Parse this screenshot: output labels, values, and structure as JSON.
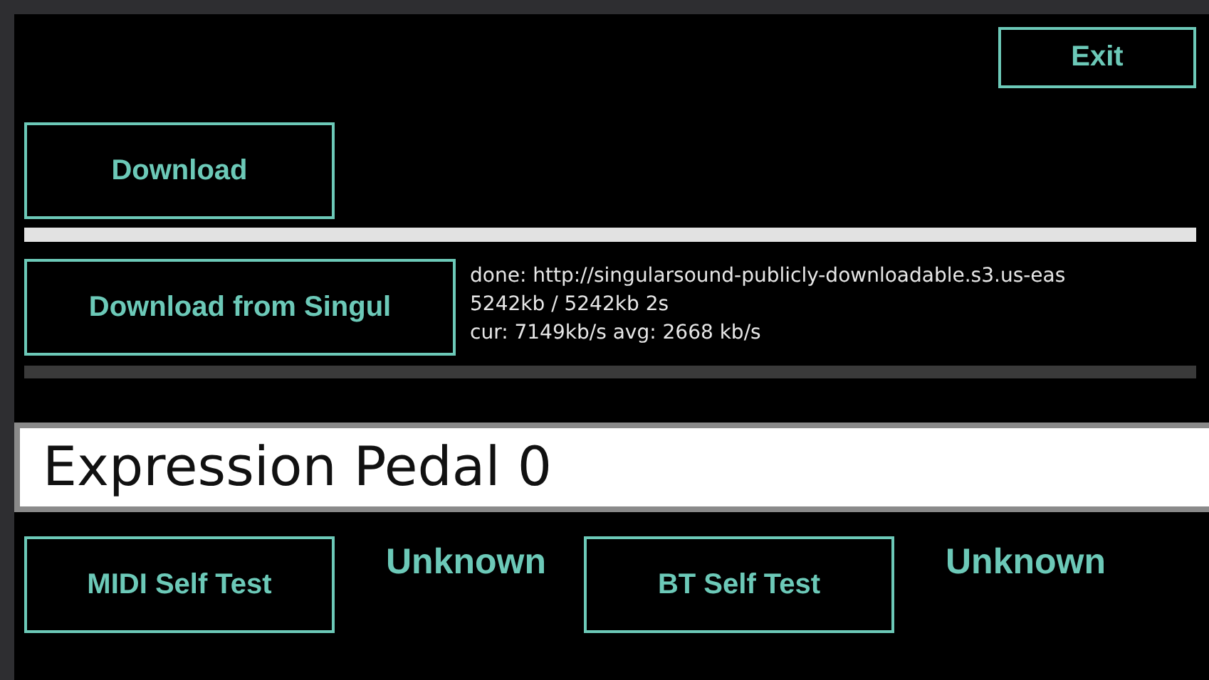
{
  "exit_button": {
    "label": "Exit"
  },
  "download_button": {
    "label": "Download"
  },
  "download_progress": {
    "level": 1
  },
  "singular_button": {
    "label": "Download from Singul"
  },
  "transfer_info": [
    "done: http://singularsound-publicly-downloadable.s3.us-eas",
    "5242kb / 5242kb 2s",
    "cur: 7149kb/s  avg: 2668 kb/s"
  ],
  "singular_progress": {
    "level": 0
  },
  "pedal_display": {
    "value": "Expression Pedal 0"
  },
  "self_tests": [
    {
      "label": "MIDI Self Test",
      "status": "Unknown"
    },
    {
      "label": "BT Self Test",
      "status": "Unknown"
    }
  ]
}
